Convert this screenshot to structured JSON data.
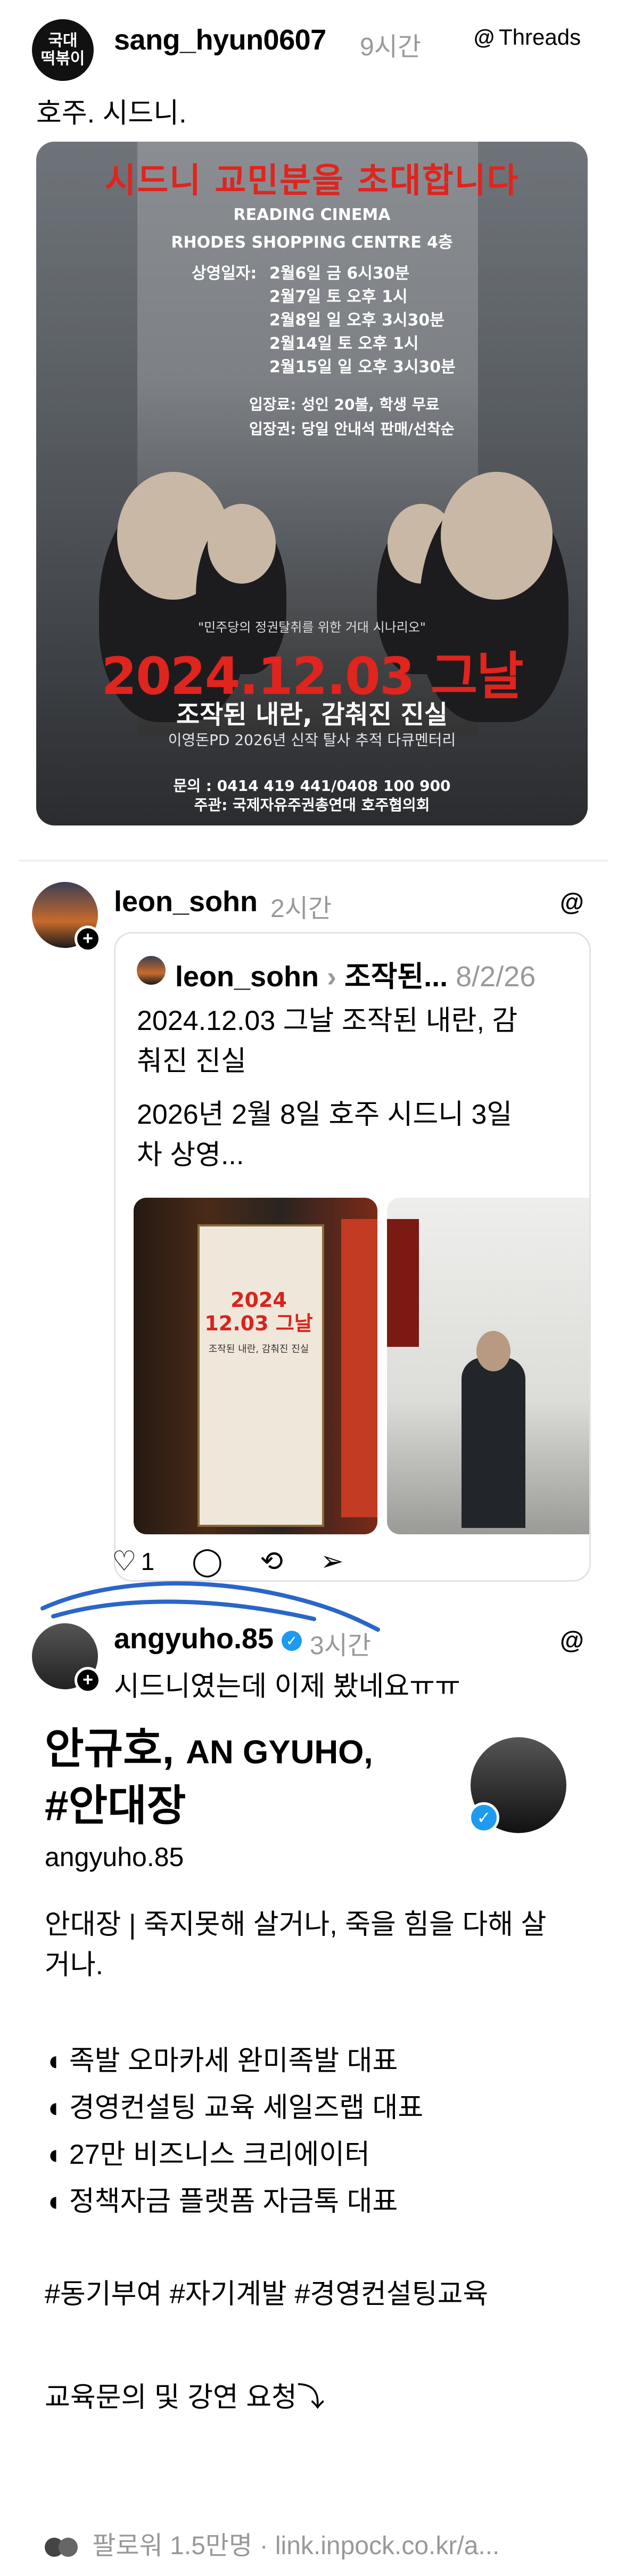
{
  "post1": {
    "avatar_text_line1": "국대",
    "avatar_text_line2": "떡볶이",
    "username": "sang_hyun0607",
    "time": "9시간",
    "badge": "Threads",
    "text": "호주. 시드니.",
    "poster": {
      "title": "시드니 교민분을 초대합니다",
      "venue1": "READING CINEMA",
      "venue2": "RHODES SHOPPING CENTRE 4층",
      "schedule_label": "상영일자:",
      "schedule": [
        "2월6일 금 6시30분",
        "2월7일 토 오후 1시",
        "2월8일 일 오후 3시30분",
        "2월14일 토 오후 1시",
        "2월15일 일 오후 3시30분"
      ],
      "fee": "입장료: 성인 20불, 학생 무료",
      "ticket": "입장권: 당일 안내석 판매/선착순",
      "tagline": "\"민주당의 정권탈취를 위한 거대 시나리오\"",
      "date": "2024.12.03 그날",
      "subtitle": "조작된 내란, 감춰진 진실",
      "small": "이영돈PD 2026년 신작 탈사 추적 다큐멘터리",
      "contact": "문의 : 0414 419 441/0408 100 900",
      "organizer": "주관: 국제자유주권총연대 호주협의회"
    }
  },
  "post2": {
    "username": "leon_sohn",
    "time": "2시간",
    "quote": {
      "username": "leon_sohn",
      "sep": "›",
      "partial": "조작된...",
      "date": "8/2/26",
      "line1": "2024.12.03 그날 조작된 내란, 감",
      "line2": "춰진 진실",
      "line3": "2026년 2월 8일 호주 시드니 3일",
      "line4": "차 상영...",
      "banner_date": "2024 12.03 그날",
      "banner_sub": "조작된 내란, 감춰진 진실"
    },
    "like_count": "1"
  },
  "post3": {
    "username": "angyuho.85",
    "time": "3시간",
    "text": "시드니였는데 이제 봤네요ㅠㅠ"
  },
  "profile": {
    "name_ko": "안규호,",
    "name_en": "AN GYUHO,",
    "name_line2": "#안대장",
    "handle": "angyuho.85",
    "bio_line1": "안대장 | 죽지못해 살거나, 죽을 힘을 다해 살",
    "bio_line2": "거나.",
    "items": [
      "족발 오마카세 완미족발 대표",
      "경영컨설팅 교육 세일즈랩 대표",
      "27만 비즈니스 크리에이터",
      "정책자금 플랫폼 자금톡 대표"
    ],
    "hashtags": "#동기부여 #자기계발 #경영컨설팅교육",
    "cta": "교육문의 및 강연 요청⤵",
    "followers": "팔로워 1.5만명",
    "link": "link.inpock.co.kr/a..."
  },
  "icons": [
    "threads-logo-icon",
    "heart-icon",
    "comment-icon",
    "repost-icon",
    "send-icon",
    "verified-icon",
    "plus-icon"
  ],
  "colors": {
    "accent_red": "#e0241e",
    "verified_blue": "#1d9bf0",
    "scribble_blue": "#2a66c9",
    "muted": "#9a9a9a"
  }
}
